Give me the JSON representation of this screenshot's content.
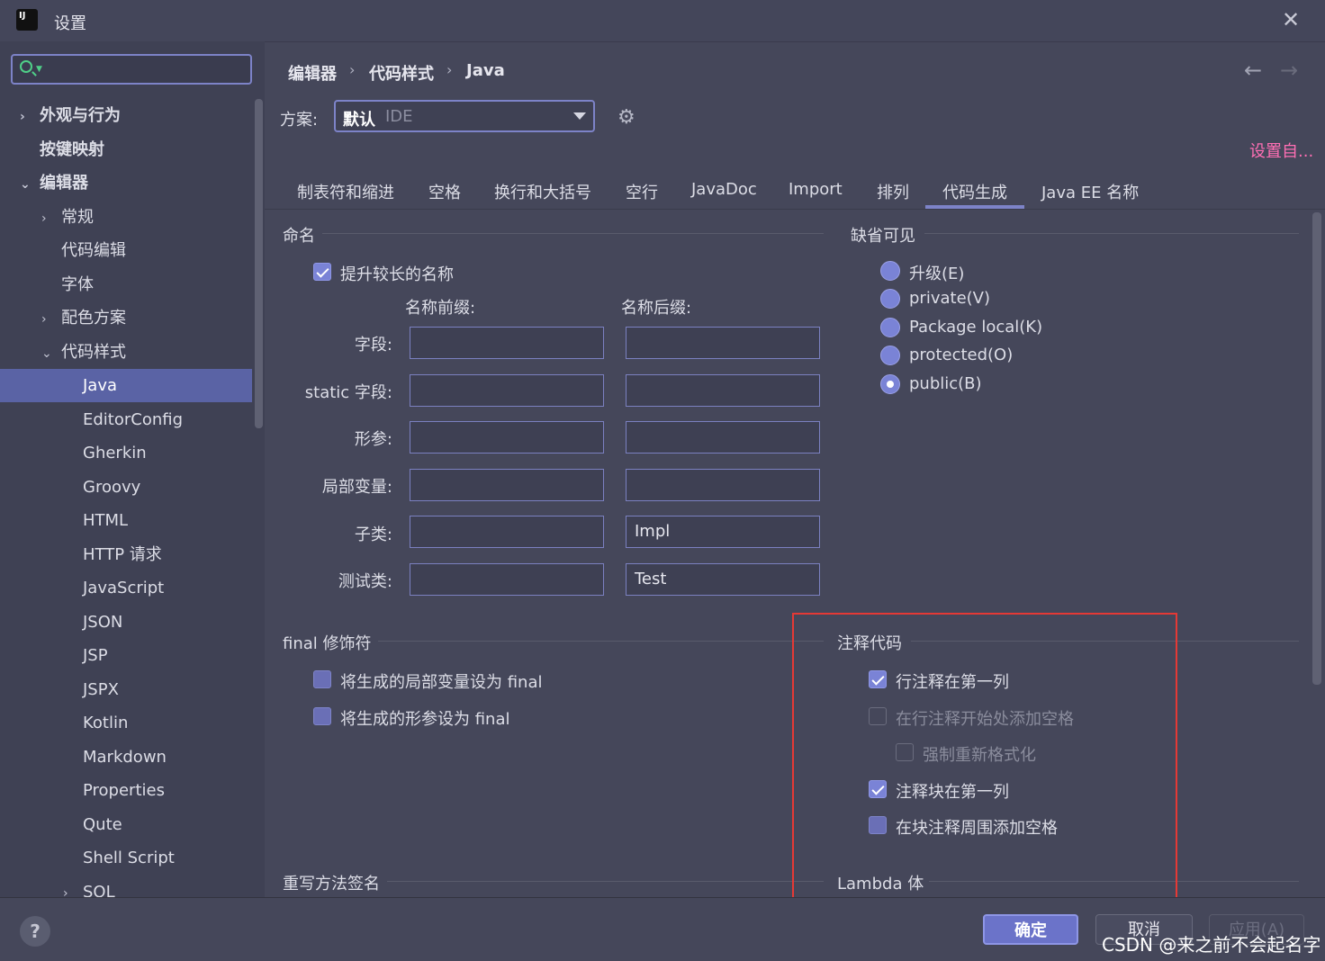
{
  "window": {
    "title": "设置",
    "app_icon": "intellij-idea-icon"
  },
  "search": {
    "value": "",
    "placeholder": ""
  },
  "sidebar": {
    "items": [
      {
        "label": "外观与行为",
        "chevron": ">",
        "level": 0,
        "bold": true
      },
      {
        "label": "按键映射",
        "chevron": "",
        "level": 0,
        "bold": true
      },
      {
        "label": "编辑器",
        "chevron": "v",
        "level": 0,
        "bold": true
      },
      {
        "label": "常规",
        "chevron": ">",
        "level": 1
      },
      {
        "label": "代码编辑",
        "chevron": "",
        "level": 1
      },
      {
        "label": "字体",
        "chevron": "",
        "level": 1
      },
      {
        "label": "配色方案",
        "chevron": ">",
        "level": 1
      },
      {
        "label": "代码样式",
        "chevron": "v",
        "level": 1
      },
      {
        "label": "Java",
        "chevron": "",
        "level": 2,
        "selected": true
      },
      {
        "label": "EditorConfig",
        "chevron": "",
        "level": 2
      },
      {
        "label": "Gherkin",
        "chevron": "",
        "level": 2
      },
      {
        "label": "Groovy",
        "chevron": "",
        "level": 2
      },
      {
        "label": "HTML",
        "chevron": "",
        "level": 2
      },
      {
        "label": "HTTP 请求",
        "chevron": "",
        "level": 2
      },
      {
        "label": "JavaScript",
        "chevron": "",
        "level": 2
      },
      {
        "label": "JSON",
        "chevron": "",
        "level": 2
      },
      {
        "label": "JSP",
        "chevron": "",
        "level": 2
      },
      {
        "label": "JSPX",
        "chevron": "",
        "level": 2
      },
      {
        "label": "Kotlin",
        "chevron": "",
        "level": 2
      },
      {
        "label": "Markdown",
        "chevron": "",
        "level": 2
      },
      {
        "label": "Properties",
        "chevron": "",
        "level": 2
      },
      {
        "label": "Qute",
        "chevron": "",
        "level": 2
      },
      {
        "label": "Shell Script",
        "chevron": "",
        "level": 2
      },
      {
        "label": "SQL",
        "chevron": ">",
        "level": 2
      }
    ]
  },
  "breadcrumb": [
    "编辑器",
    "代码样式",
    "Java"
  ],
  "nav": {
    "back": "←",
    "forward": "→"
  },
  "scheme": {
    "label": "方案:",
    "value": "默认",
    "sub": "IDE"
  },
  "set_from_link": "设置自...",
  "tabs": [
    "制表符和缩进",
    "空格",
    "换行和大括号",
    "空行",
    "JavaDoc",
    "Import",
    "排列",
    "代码生成",
    "Java EE 名称"
  ],
  "active_tab": "代码生成",
  "naming": {
    "title": "命名",
    "prefer_longer": {
      "label": "提升较长的名称",
      "checked": true
    },
    "prefix_header": "名称前缀:",
    "suffix_header": "名称后缀:",
    "rows": [
      {
        "label": "字段:",
        "prefix": "",
        "suffix": ""
      },
      {
        "label": "static 字段:",
        "prefix": "",
        "suffix": ""
      },
      {
        "label": "形参:",
        "prefix": "",
        "suffix": ""
      },
      {
        "label": "局部变量:",
        "prefix": "",
        "suffix": ""
      },
      {
        "label": "子类:",
        "prefix": "",
        "suffix": "Impl"
      },
      {
        "label": "测试类:",
        "prefix": "",
        "suffix": "Test"
      }
    ]
  },
  "visibility": {
    "title": "缺省可见",
    "options": [
      {
        "label": "升级(E)",
        "selected": false
      },
      {
        "label": "private(V)",
        "selected": false
      },
      {
        "label": "Package local(K)",
        "selected": false
      },
      {
        "label": "protected(O)",
        "selected": false
      },
      {
        "label": "public(B)",
        "selected": true
      }
    ]
  },
  "final_modifier": {
    "title": "final 修饰符",
    "options": [
      {
        "label": "将生成的局部变量设为 final",
        "checked": false
      },
      {
        "label": "将生成的形参设为 final",
        "checked": false
      }
    ]
  },
  "comment_code": {
    "title": "注释代码",
    "options": [
      {
        "label": "行注释在第一列",
        "checked": true
      },
      {
        "label": "在行注释开始处添加空格",
        "checked": false,
        "disabled": true
      },
      {
        "label": "强制重新格式化",
        "checked": false,
        "disabled": true
      },
      {
        "label": "注释块在第一列",
        "checked": true
      },
      {
        "label": "在块注释周围添加空格",
        "checked": false
      }
    ]
  },
  "override_title": "重写方法签名",
  "lambda_title": "Lambda 体",
  "buttons": {
    "ok": "确定",
    "cancel": "取消",
    "apply": "应用(A)",
    "help": "?"
  },
  "watermark": "CSDN @来之前不会起名字",
  "colors": {
    "accent": "#7a83d6",
    "selection": "#5a63a5",
    "link": "#ff6fb4",
    "highlight_box": "#e53935"
  }
}
